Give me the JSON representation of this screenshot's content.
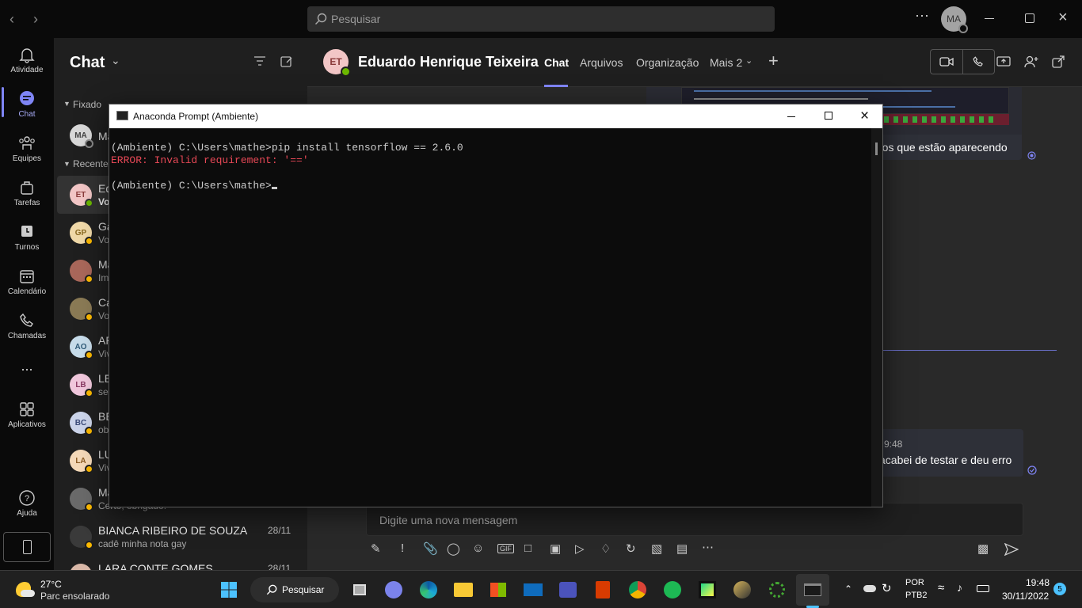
{
  "titlebar": {
    "search_placeholder": "Pesquisar",
    "user_initials": "MA"
  },
  "rail": {
    "items": [
      {
        "label": "Atividade"
      },
      {
        "label": "Chat"
      },
      {
        "label": "Equipes"
      },
      {
        "label": "Tarefas"
      },
      {
        "label": "Turnos"
      },
      {
        "label": "Calendário"
      },
      {
        "label": "Chamadas"
      },
      {
        "label": "Aplicativos"
      },
      {
        "label": "Ajuda"
      }
    ],
    "more": "..."
  },
  "chatlist": {
    "title": "Chat",
    "pinned_label": "Fixado",
    "recent_label": "Recentes",
    "items": [
      {
        "initials": "MA",
        "name": "Ma",
        "preview": ""
      },
      {
        "initials": "ET",
        "name": "Ed",
        "preview": "Vo"
      },
      {
        "initials": "GP",
        "name": "Ga",
        "preview": "Vo"
      },
      {
        "initials": "",
        "name": "Ma",
        "preview": "Im"
      },
      {
        "initials": "",
        "name": "Ca",
        "preview": "Vo"
      },
      {
        "initials": "AO",
        "name": "AR",
        "preview": "Viv"
      },
      {
        "initials": "LB",
        "name": "LE",
        "preview": "ser"
      },
      {
        "initials": "BC",
        "name": "BE",
        "preview": "ob"
      },
      {
        "initials": "LA",
        "name": "LU",
        "preview": "Viv"
      },
      {
        "initials": "",
        "name": "Ma",
        "preview": "Certo, obrigado!"
      },
      {
        "initials": "",
        "name": "BIANCA RIBEIRO DE SOUZA",
        "preview": "cadê minha nota gay",
        "date": "28/11"
      },
      {
        "initials": "",
        "name": "LARA CONTE GOMES",
        "preview": "",
        "date": "28/11"
      }
    ]
  },
  "conversation": {
    "avatar_initials": "ET",
    "name": "Eduardo Henrique Teixeira",
    "tabs": [
      {
        "label": "Chat"
      },
      {
        "label": "Arquivos"
      },
      {
        "label": "Organização"
      },
      {
        "label": "Mais 2"
      }
    ],
    "msg1_tail": "ros que estão aparecendo",
    "msg2_time": "9:48",
    "msg2_tail": "acabei de testar e deu erro",
    "compose_placeholder": "Digite uma nova mensagem"
  },
  "cmd": {
    "title": "Anaconda Prompt (Ambiente)",
    "line1": "(Ambiente) C:\\Users\\mathe>pip install tensorflow == 2.6.0",
    "line2": "ERROR: Invalid requirement: '=='",
    "line3": "(Ambiente) C:\\Users\\mathe>"
  },
  "taskbar": {
    "weather_temp": "27°C",
    "weather_desc": "Parc ensolarado",
    "search_label": "Pesquisar",
    "lang_top": "POR",
    "lang_bottom": "PTB2",
    "time": "19:48",
    "date": "30/11/2022",
    "notif_count": "5"
  },
  "colors": {
    "accent": "#7f85f5",
    "error": "#e74856",
    "available": "#6bb700",
    "away": "#fcb900"
  }
}
